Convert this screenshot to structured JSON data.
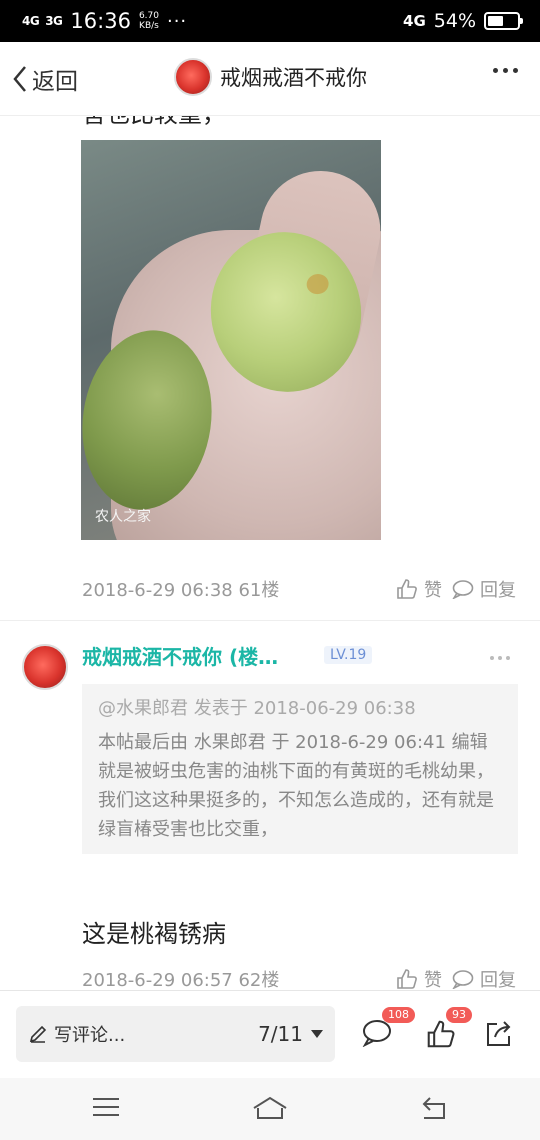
{
  "status_bar": {
    "signal1": "4G",
    "signal2": "3G",
    "time": "16:36",
    "speed_value": "6.70",
    "speed_unit": "KB/s",
    "dots": "···",
    "network": "4G",
    "battery_text": "54%",
    "battery_level": 0.54
  },
  "nav": {
    "back_label": "返回",
    "title": "戒烟戒酒不戒你"
  },
  "post61": {
    "cut_text": "害也比较重，",
    "image_watermark": "农人之家",
    "meta": "2018-6-29 06:38  61楼",
    "like_label": "赞",
    "reply_label": "回复"
  },
  "post62": {
    "username": "戒烟戒酒不戒你 (楼…",
    "level": "LV.19",
    "quote_head": "@水果郎君 发表于 2018-06-29 06:38",
    "quote_body": "本帖最后由 水果郎君 于 2018-6-29 06:41 编辑 就是被蚜虫危害的油桃下面的有黄斑的毛桃幼果，我们这这种果挺多的，不知怎么造成的，还有就是绿盲椿受害也比交重，",
    "text": "这是桃褐锈病",
    "meta": "2018-6-29 06:57  62楼",
    "like_label": "赞",
    "reply_label": "回复"
  },
  "bottom_bar": {
    "comment_placeholder": "写评论...",
    "page_indicator": "7/11",
    "comment_count": "108",
    "like_count": "93"
  },
  "icons": {
    "back": "chevron-left-icon",
    "more": "more-dots-icon",
    "like": "thumb-up-icon",
    "reply": "speech-bubble-icon",
    "pen": "pen-icon",
    "dropdown": "triangle-down-icon",
    "share": "share-icon",
    "menu": "menu-icon",
    "home": "home-icon",
    "back_system": "return-icon"
  },
  "colors": {
    "username": "#1bb6a6",
    "badge": "#f25b57",
    "level": "#6c8fd5"
  }
}
